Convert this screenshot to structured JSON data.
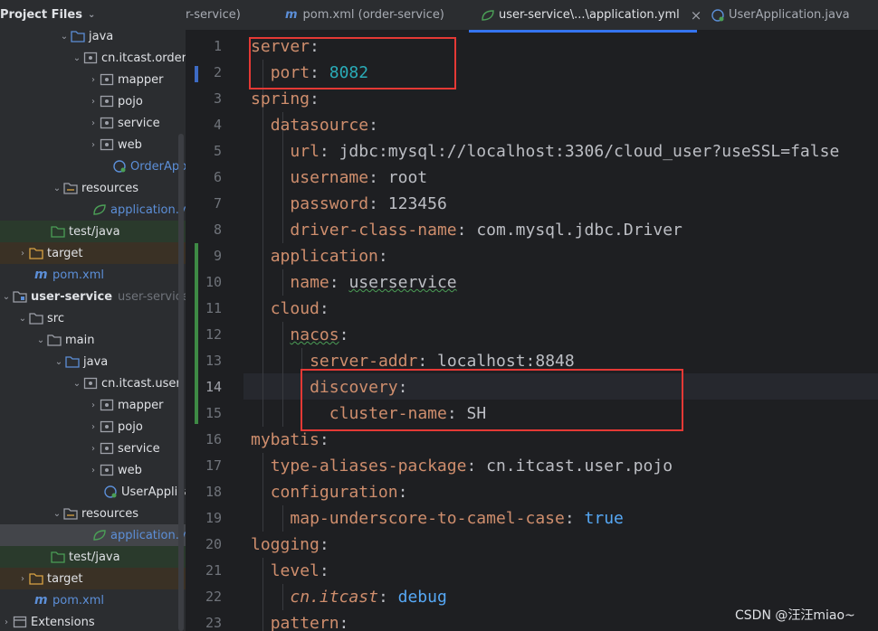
{
  "project_panel": {
    "title": "Project Files",
    "rows": [
      {
        "label": "java",
        "muted": ""
      },
      {
        "label": "cn.itcast.order",
        "muted": ""
      },
      {
        "label": "mapper",
        "muted": ""
      },
      {
        "label": "pojo",
        "muted": ""
      },
      {
        "label": "service",
        "muted": ""
      },
      {
        "label": "web",
        "muted": ""
      },
      {
        "label": "OrderApplic",
        "muted": ""
      },
      {
        "label": "resources",
        "muted": ""
      },
      {
        "label": "application.yml",
        "muted": ""
      },
      {
        "label": "test/java",
        "muted": ""
      },
      {
        "label": "target",
        "muted": ""
      },
      {
        "label": "pom.xml",
        "muted": ""
      },
      {
        "label": "user-service",
        "muted": "user-service"
      },
      {
        "label": "src",
        "muted": ""
      },
      {
        "label": "main",
        "muted": ""
      },
      {
        "label": "java",
        "muted": ""
      },
      {
        "label": "cn.itcast.user",
        "muted": ""
      },
      {
        "label": "mapper",
        "muted": ""
      },
      {
        "label": "pojo",
        "muted": ""
      },
      {
        "label": "service",
        "muted": ""
      },
      {
        "label": "web",
        "muted": ""
      },
      {
        "label": "UserApplica",
        "muted": ""
      },
      {
        "label": "resources",
        "muted": ""
      },
      {
        "label": "application.yml",
        "muted": ""
      },
      {
        "label": "test/java",
        "muted": ""
      },
      {
        "label": "target",
        "muted": ""
      },
      {
        "label": "pom.xml",
        "muted": ""
      },
      {
        "label": "Extensions",
        "muted": ""
      }
    ]
  },
  "tabs": [
    {
      "label": "r-service)"
    },
    {
      "label": "pom.xml (order-service)"
    },
    {
      "label": "user-service\\...\\application.yml"
    },
    {
      "label": "UserApplication.java"
    }
  ],
  "icons": {
    "tab_close": "×"
  },
  "editor": {
    "line_numbers": [
      "1",
      "2",
      "3",
      "4",
      "5",
      "6",
      "7",
      "8",
      "9",
      "10",
      "11",
      "12",
      "13",
      "14",
      "15",
      "16",
      "17",
      "18",
      "19",
      "20",
      "21",
      "22",
      "23"
    ],
    "lines": [
      {
        "key": "server",
        "sep": ":",
        "val": ""
      },
      {
        "key": "port",
        "sep": ": ",
        "val": "8082"
      },
      {
        "key": "spring",
        "sep": ":",
        "val": ""
      },
      {
        "key": "datasource",
        "sep": ":",
        "val": ""
      },
      {
        "key": "url",
        "sep": ": ",
        "val": "jdbc:mysql://localhost:3306/cloud_user?useSSL=false"
      },
      {
        "key": "username",
        "sep": ": ",
        "val": "root"
      },
      {
        "key": "password",
        "sep": ": ",
        "val": "123456"
      },
      {
        "key": "driver-class-name",
        "sep": ": ",
        "val": "com.mysql.jdbc.Driver"
      },
      {
        "key": "application",
        "sep": ":",
        "val": ""
      },
      {
        "key": "name",
        "sep": ": ",
        "val": "userservice"
      },
      {
        "key": "cloud",
        "sep": ":",
        "val": ""
      },
      {
        "key": "nacos",
        "sep": ":",
        "val": ""
      },
      {
        "key": "server-addr",
        "sep": ": ",
        "val": "localhost:8848"
      },
      {
        "key": "discovery",
        "sep": ":",
        "val": ""
      },
      {
        "key": "cluster-name",
        "sep": ": ",
        "val": "SH"
      },
      {
        "key": "mybatis",
        "sep": ":",
        "val": ""
      },
      {
        "key": "type-aliases-package",
        "sep": ": ",
        "val": "cn.itcast.user.pojo"
      },
      {
        "key": "configuration",
        "sep": ":",
        "val": ""
      },
      {
        "key": "map-underscore-to-camel-case",
        "sep": ": ",
        "val": "true"
      },
      {
        "key": "logging",
        "sep": ":",
        "val": ""
      },
      {
        "key": "level",
        "sep": ":",
        "val": ""
      },
      {
        "key": "cn.itcast",
        "sep": ": ",
        "val": "debug"
      },
      {
        "key": "pattern",
        "sep": ":",
        "val": ""
      }
    ]
  },
  "colors": {
    "highlight_box": "#e53935",
    "tab_active_underline": "#3574f0",
    "vcs_modified": "#3d6bc4",
    "vcs_added": "#3e8a45"
  },
  "watermark": "CSDN @汪汪miao~"
}
